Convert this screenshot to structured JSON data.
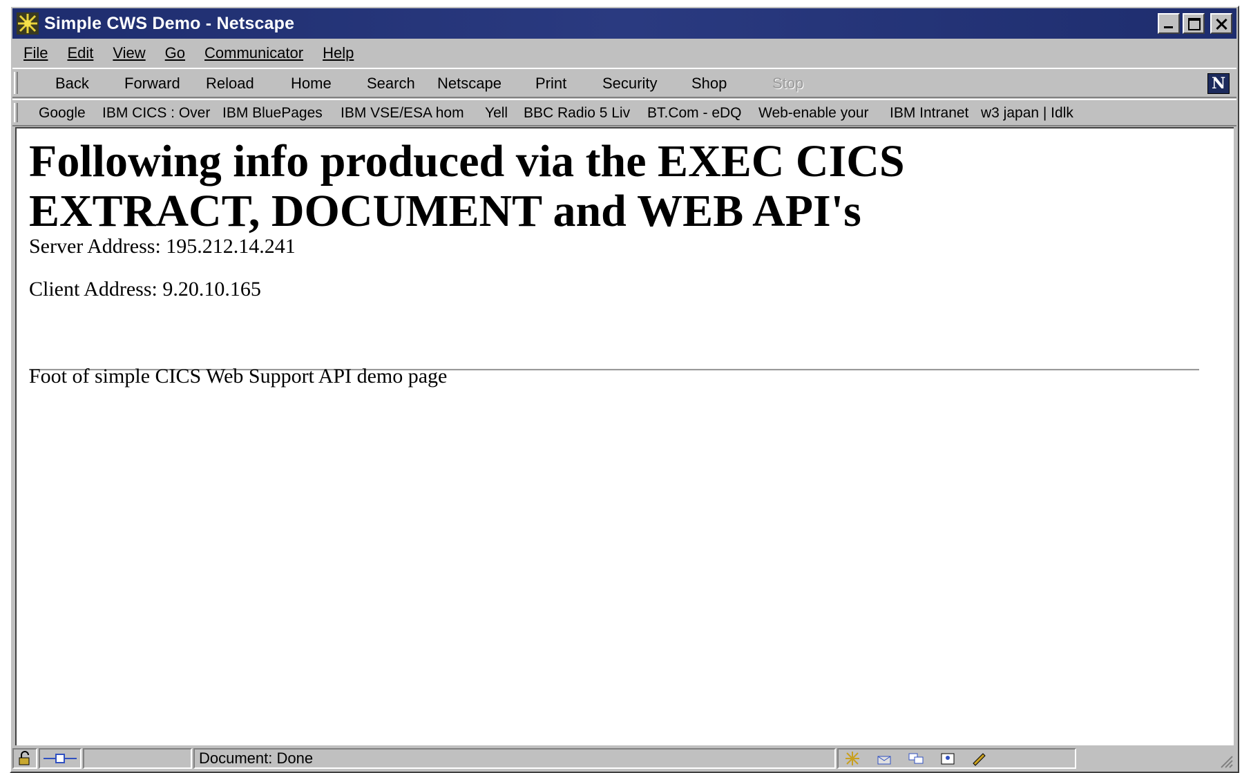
{
  "window": {
    "title": "Simple CWS Demo - Netscape"
  },
  "menu": [
    "File",
    "Edit",
    "View",
    "Go",
    "Communicator",
    "Help"
  ],
  "navigation": {
    "buttons": [
      {
        "label": "Back",
        "enabled": true
      },
      {
        "label": "Forward",
        "enabled": true
      },
      {
        "label": "Reload",
        "enabled": true
      },
      {
        "label": "Home",
        "enabled": true
      },
      {
        "label": "Search",
        "enabled": true
      },
      {
        "label": "Netscape",
        "enabled": true
      },
      {
        "label": "Print",
        "enabled": true
      },
      {
        "label": "Security",
        "enabled": true
      },
      {
        "label": "Shop",
        "enabled": true
      },
      {
        "label": "Stop",
        "enabled": false
      }
    ],
    "logo_letter": "N"
  },
  "bookmarks": [
    "Google",
    "IBM CICS : Over",
    "IBM BluePages",
    "IBM VSE/ESA hom",
    "Yell",
    "BBC Radio 5 Liv",
    "BT.Com - eDQ",
    "Web-enable your",
    "IBM Intranet",
    "w3 japan | Idlk"
  ],
  "page": {
    "heading": "Following info produced via the EXEC CICS EXTRACT, DOCUMENT and WEB API's",
    "server_address": "Server Address: 195.212.14.241",
    "client_address": "Client Address: 9.20.10.165",
    "footer_text": "Foot of simple CICS Web Support API demo page"
  },
  "status": {
    "message": "Document: Done"
  },
  "colors": {
    "titlebar": "#1e2d6e",
    "chrome": "#c0c0c0",
    "content_bg": "#ffffff"
  }
}
